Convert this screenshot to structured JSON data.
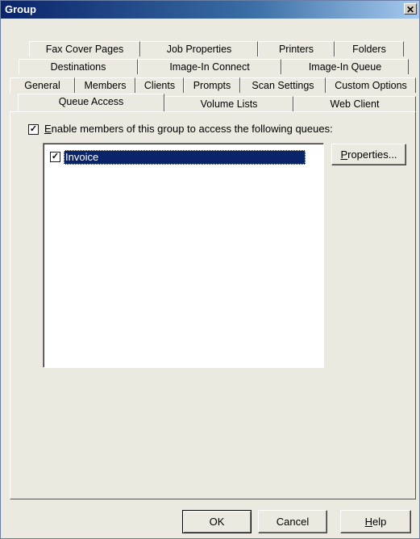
{
  "window": {
    "title": "Group",
    "close_glyph": "✕"
  },
  "tabs": {
    "row1": [
      "Fax Cover Pages",
      "Job Properties",
      "Printers",
      "Folders"
    ],
    "row2": [
      "Destinations",
      "Image-In Connect",
      "Image-In Queue"
    ],
    "row3": [
      "General",
      "Members",
      "Clients",
      "Prompts",
      "Scan Settings",
      "Custom Options"
    ],
    "row4": [
      "Queue Access",
      "Volume Lists",
      "Web Client"
    ],
    "active": "Queue Access"
  },
  "queue_access": {
    "enable_checked": true,
    "enable_label_mnemonic": "E",
    "enable_label_rest": "nable members of this group to access the following queues:",
    "queues": [
      {
        "name": "Invoice",
        "checked": true,
        "selected": true
      }
    ],
    "properties_mnemonic": "P",
    "properties_rest": "roperties..."
  },
  "footer": {
    "ok_label": "OK",
    "cancel_label": "Cancel",
    "help_mnemonic": "H",
    "help_rest": "elp"
  }
}
